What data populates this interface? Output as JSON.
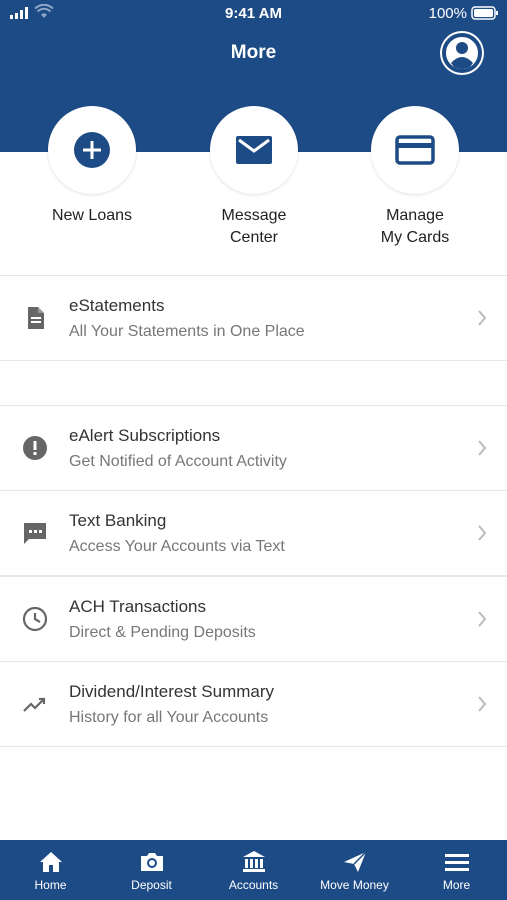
{
  "status": {
    "time": "9:41 AM",
    "battery": "100%"
  },
  "header": {
    "title": "More"
  },
  "quick_actions": [
    {
      "label": "New Loans",
      "icon": "plus-circle-icon"
    },
    {
      "label": "Message\nCenter",
      "icon": "envelope-icon"
    },
    {
      "label": "Manage\nMy Cards",
      "icon": "credit-card-icon"
    }
  ],
  "menu": [
    {
      "title": "eStatements",
      "subtitle": "All Your Statements in One Place",
      "icon": "document-icon"
    },
    {
      "title": "eAlert Subscriptions",
      "subtitle": "Get Notified of Account Activity",
      "icon": "alert-icon"
    },
    {
      "title": "Text Banking",
      "subtitle": "Access Your Accounts via Text",
      "icon": "chat-icon"
    },
    {
      "title": "ACH Transactions",
      "subtitle": "Direct & Pending Deposits",
      "icon": "clock-icon"
    },
    {
      "title": "Dividend/Interest Summary",
      "subtitle": "History for all Your Accounts",
      "icon": "trending-up-icon"
    }
  ],
  "tabs": [
    {
      "label": "Home",
      "icon": "home-icon"
    },
    {
      "label": "Deposit",
      "icon": "camera-icon"
    },
    {
      "label": "Accounts",
      "icon": "bank-icon"
    },
    {
      "label": "Move Money",
      "icon": "send-icon"
    },
    {
      "label": "More",
      "icon": "menu-icon"
    }
  ],
  "colors": {
    "brand": "#1d4b86",
    "icon_gray": "#666666",
    "chevron": "#bbbbbb"
  }
}
